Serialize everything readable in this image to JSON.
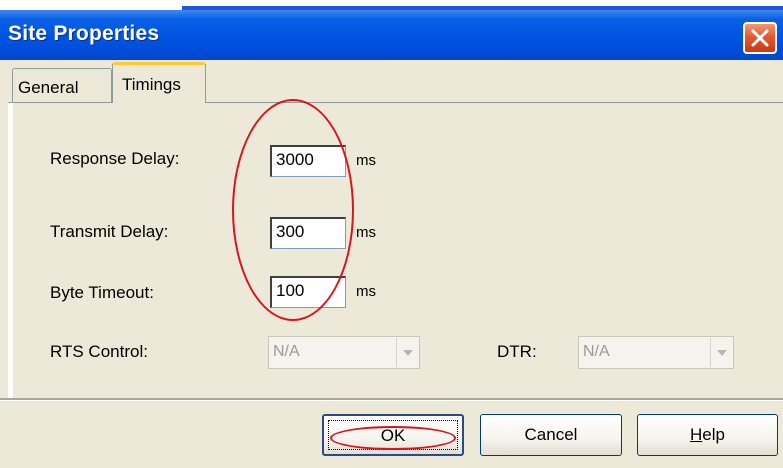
{
  "window": {
    "title": "Site Properties"
  },
  "tabs": {
    "general": "General",
    "timings": "Timings",
    "active": "Timings"
  },
  "timings": {
    "response_delay": {
      "label": "Response Delay:",
      "value": "3000",
      "unit": "ms"
    },
    "transmit_delay": {
      "label": "Transmit Delay:",
      "value": "300",
      "unit": "ms"
    },
    "byte_timeout": {
      "label": "Byte Timeout:",
      "value": "100",
      "unit": "ms"
    },
    "rts_control": {
      "label": "RTS Control:",
      "value": "N/A",
      "disabled": true
    },
    "dtr": {
      "label": "DTR:",
      "value": "N/A",
      "disabled": true
    }
  },
  "buttons": {
    "ok": "OK",
    "cancel": "Cancel",
    "help": "Help"
  },
  "annotations": {
    "color": "#d8141e"
  },
  "colors": {
    "titlebar": "#0054e3",
    "dialog_bg": "#ece9d8",
    "close_button": "#e45a2f",
    "active_tab_accent": "#ffc83c"
  }
}
